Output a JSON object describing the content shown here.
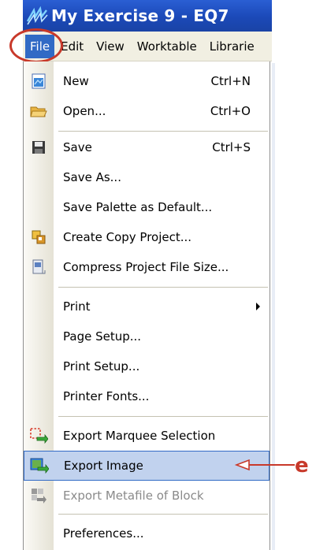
{
  "window": {
    "title": "My Exercise 9 - EQ7"
  },
  "menubar": {
    "items": [
      {
        "label": "File"
      },
      {
        "label": "Edit"
      },
      {
        "label": "View"
      },
      {
        "label": "Worktable"
      },
      {
        "label": "Librarie"
      }
    ]
  },
  "file_menu": {
    "new": {
      "label": "New",
      "shortcut": "Ctrl+N"
    },
    "open": {
      "label": "Open...",
      "shortcut": "Ctrl+O"
    },
    "save": {
      "label": "Save",
      "shortcut": "Ctrl+S"
    },
    "save_as": {
      "label": "Save As..."
    },
    "save_palette": {
      "label": "Save Palette as Default..."
    },
    "create_copy": {
      "label": "Create Copy Project..."
    },
    "compress": {
      "label": "Compress Project File Size..."
    },
    "print": {
      "label": "Print"
    },
    "page_setup": {
      "label": "Page Setup..."
    },
    "print_setup": {
      "label": "Print Setup..."
    },
    "printer_fonts": {
      "label": "Printer Fonts..."
    },
    "export_marquee": {
      "label": "Export Marquee Selection"
    },
    "export_image": {
      "label": "Export Image"
    },
    "export_metafile": {
      "label": "Export Metafile of Block"
    },
    "preferences": {
      "label": "Preferences..."
    }
  },
  "annotation": {
    "label": "e",
    "color": "#c8392a"
  },
  "colors": {
    "titlebar": "#1b49b8",
    "menu_active": "#316ac5",
    "selected_item": "#c1d2ee"
  }
}
